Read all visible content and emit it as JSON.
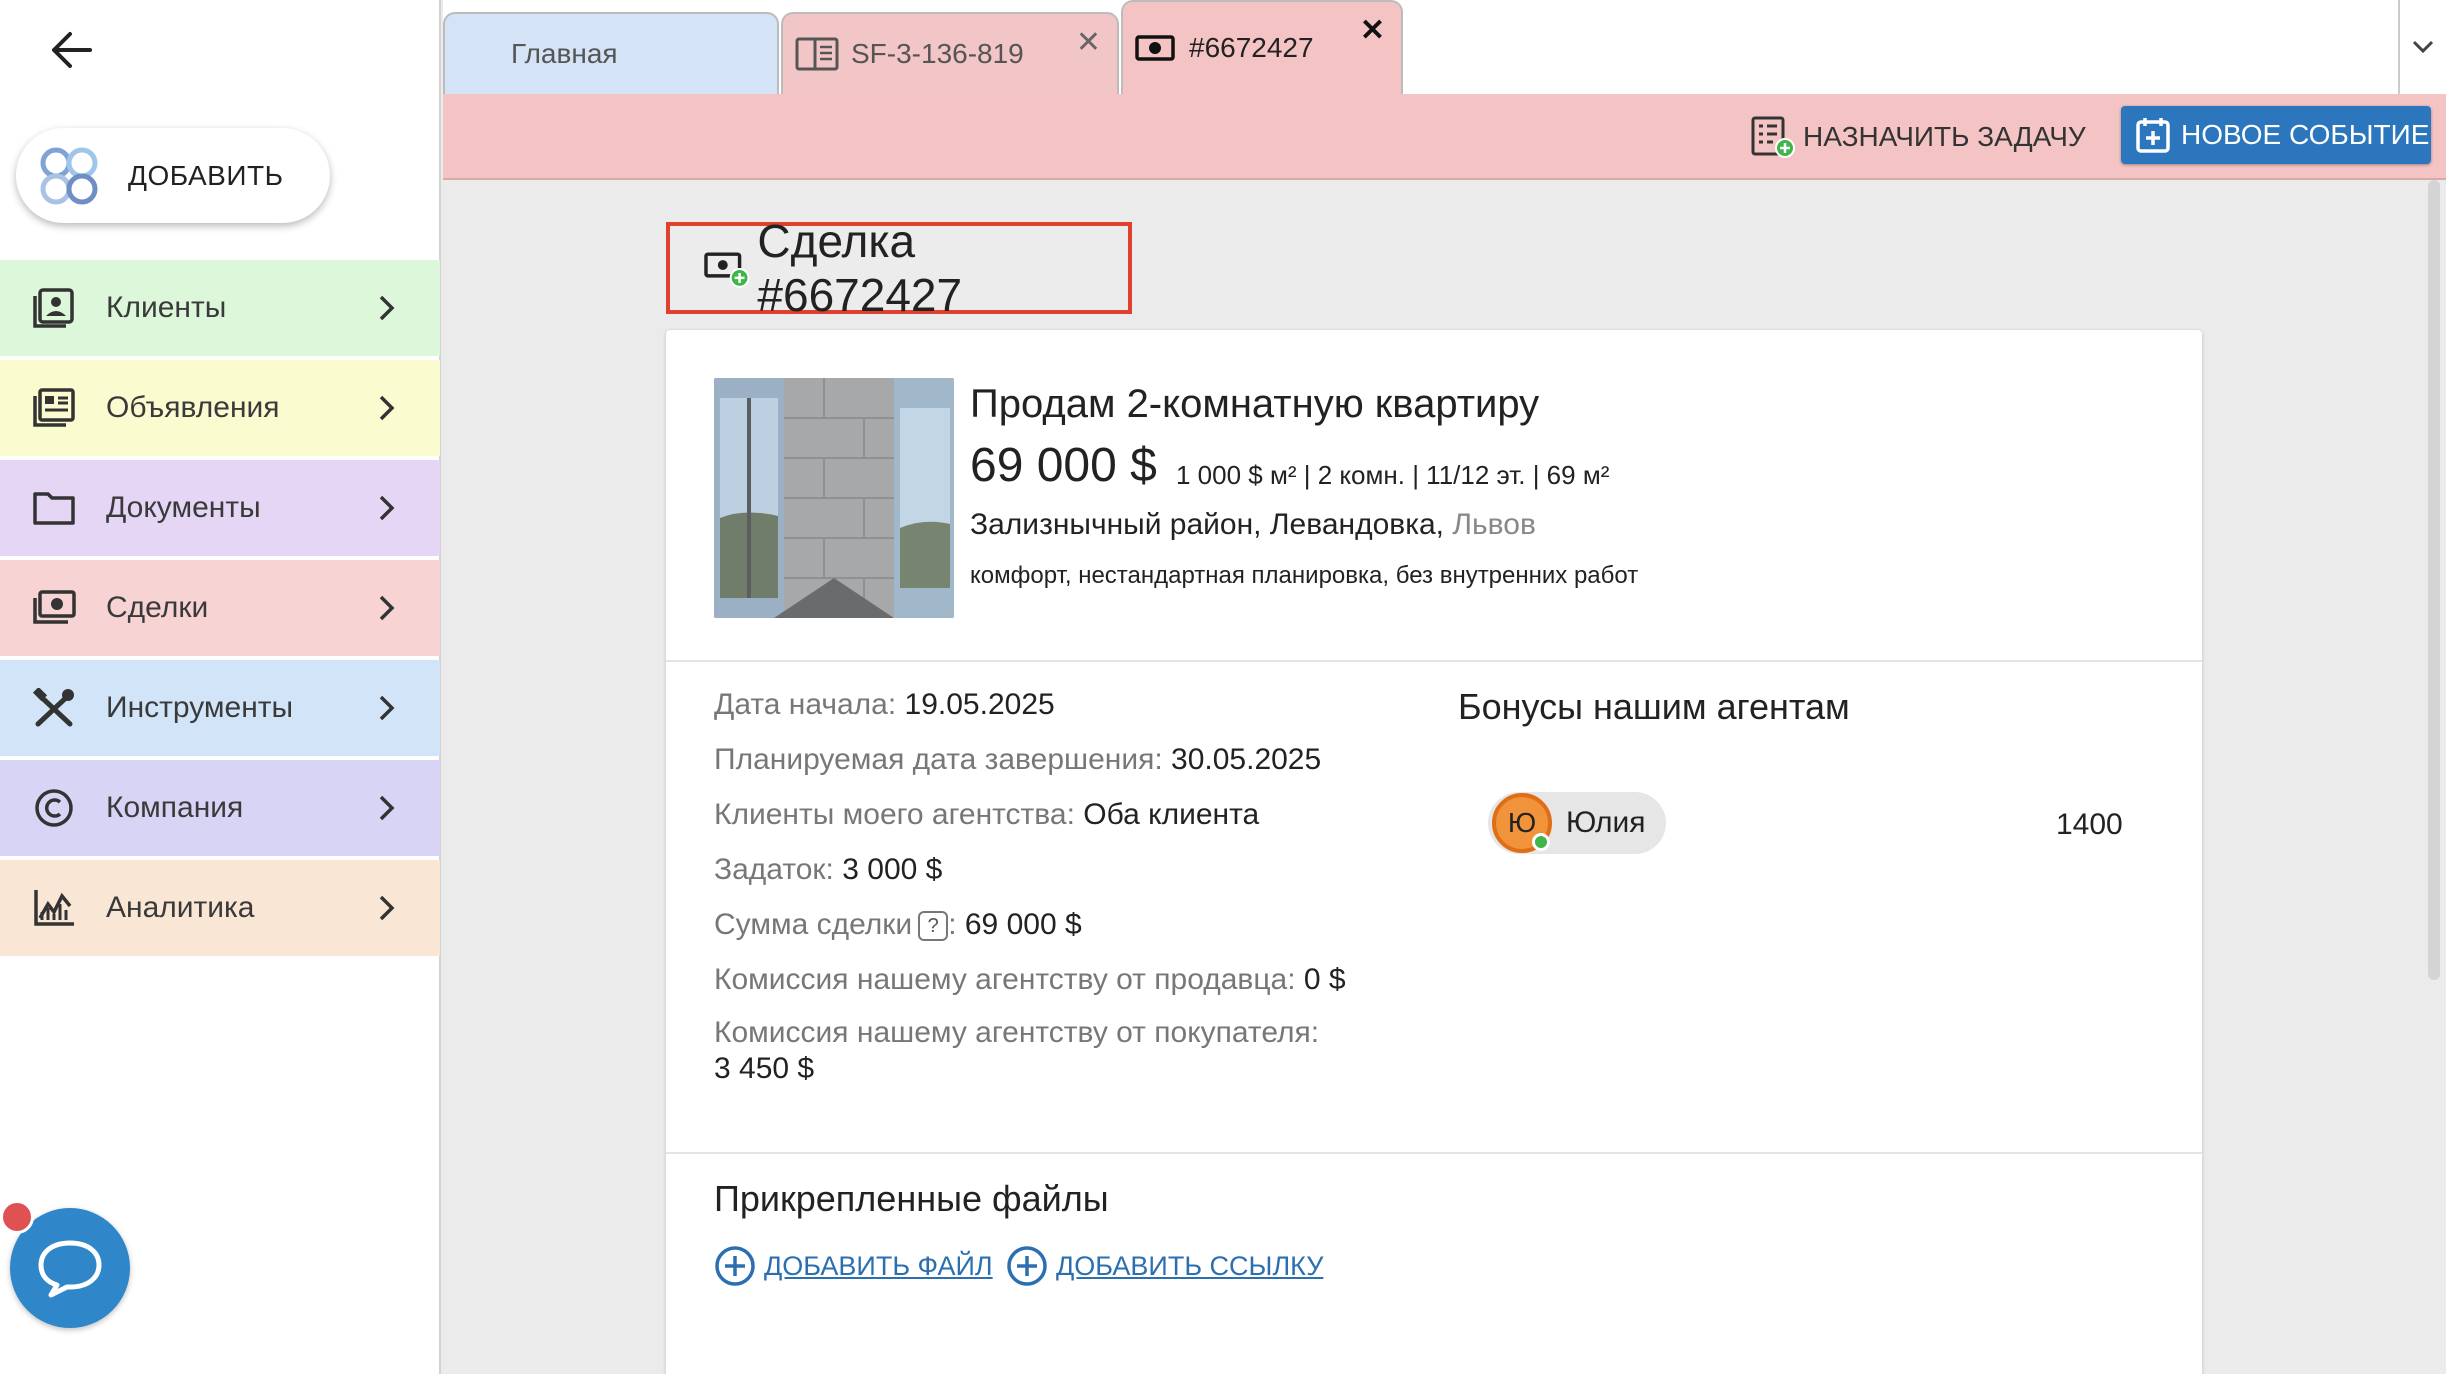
{
  "sidebar": {
    "add_label": "ДОБАВИТЬ",
    "items": [
      {
        "label": "Клиенты",
        "icon": "contacts-icon",
        "color": "#dcf7d9"
      },
      {
        "label": "Объявления",
        "icon": "listings-icon",
        "color": "#fbfbd0"
      },
      {
        "label": "Документы",
        "icon": "folder-icon",
        "color": "#e5d6f6"
      },
      {
        "label": "Сделки",
        "icon": "cash-icon",
        "color": "#f7d3d3"
      },
      {
        "label": "Инструменты",
        "icon": "tools-icon",
        "color": "#d2e5f8"
      },
      {
        "label": "Компания",
        "icon": "copyright-icon",
        "color": "#d8d4f6"
      },
      {
        "label": "Аналитика",
        "icon": "chart-icon",
        "color": "#fae6d4"
      }
    ]
  },
  "tabs": [
    {
      "label": "Главная",
      "closable": false
    },
    {
      "label": "SF-3-136-819",
      "closable": true
    },
    {
      "label": "#6672427",
      "closable": true,
      "active": true
    }
  ],
  "toolbar": {
    "assign_label": "НАЗНАЧИТЬ ЗАДАЧУ",
    "new_event_label": "НОВОЕ СОБЫТИЕ"
  },
  "deal": {
    "title": "Сделка #6672427",
    "listing": {
      "title": "Продам 2-комнатную квартиру",
      "price": "69 000 $",
      "specs": "1 000 $ м² | 2 комн. | 11/12 эт. | 69 м²",
      "location": "Зализнычный район, Левандовка, ",
      "city": "Львов",
      "description": "комфорт, нестандартная планировка, без внутренних работ"
    },
    "fields": {
      "start_label": "Дата начала:",
      "start_value": "19.05.2025",
      "planned_end_label": "Планируемая дата завершения:",
      "planned_end_value": "30.05.2025",
      "clients_label": "Клиенты моего агентства:",
      "clients_value": "Оба клиента",
      "deposit_label": "Задаток:",
      "deposit_value": "3 000 $",
      "sum_label": "Сумма сделки",
      "sum_help": "?",
      "sum_colon": ":",
      "sum_value": "69 000 $",
      "seller_comm_label": "Комиссия нашему агентству от продавца:",
      "seller_comm_value": "0 $",
      "buyer_comm_label": "Комиссия нашему агентству от покупателя:",
      "buyer_comm_value": "3 450 $"
    },
    "bonuses": {
      "title": "Бонусы нашим агентам",
      "agent_initial": "Ю",
      "agent_name": "Юлия",
      "agent_bonus": "1400"
    },
    "files": {
      "title": "Прикрепленные файлы",
      "add_file": "ДОБАВИТЬ ФАЙЛ",
      "add_link": "ДОБАВИТЬ ССЫЛКУ"
    }
  },
  "colors": {
    "accent_blue": "#2b76bd",
    "deal_pink": "#f4c4c4",
    "highlight_red": "#e0412f",
    "link_blue": "#2b6fb0",
    "online_green": "#3fb54a"
  }
}
